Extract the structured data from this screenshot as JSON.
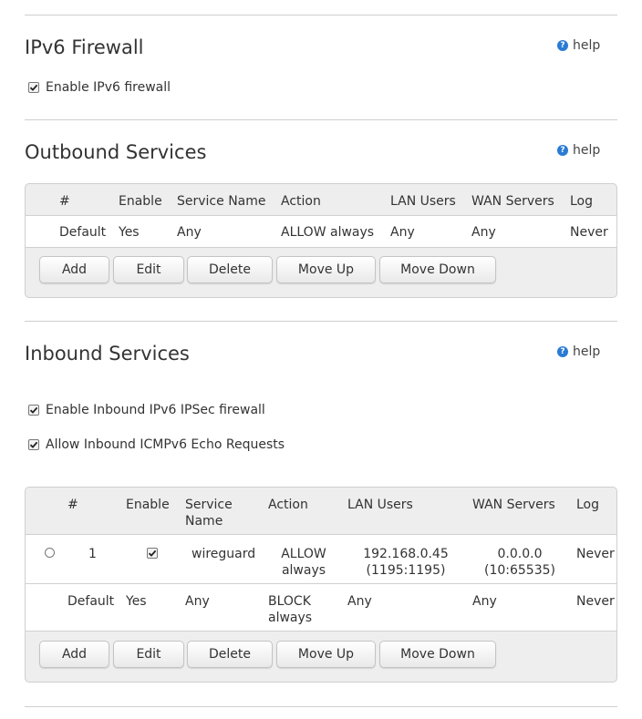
{
  "help_label": "help",
  "help_glyph": "?",
  "colors": {
    "accent": "#2a7bd4",
    "panel_bg": "#eeeeee",
    "border": "#cfcfcf",
    "text": "#333333"
  },
  "ipv6_firewall": {
    "title": "IPv6 Firewall",
    "enable_label": "Enable IPv6 firewall",
    "enable_checked": true
  },
  "outbound": {
    "title": "Outbound Services",
    "columns": [
      "#",
      "Enable",
      "Service Name",
      "Action",
      "LAN Users",
      "WAN Servers",
      "Log"
    ],
    "rows": [
      {
        "num": "Default",
        "enable": "Yes",
        "service": "Any",
        "action": "ALLOW always",
        "lan": "Any",
        "wan": "Any",
        "log": "Never"
      }
    ],
    "buttons": {
      "add": "Add",
      "edit": "Edit",
      "delete": "Delete",
      "move_up": "Move Up",
      "move_down": "Move Down"
    }
  },
  "inbound": {
    "title": "Inbound Services",
    "ipsec_label": "Enable Inbound IPv6 IPSec firewall",
    "ipsec_checked": true,
    "icmp_label": "Allow Inbound ICMPv6 Echo Requests",
    "icmp_checked": true,
    "columns": {
      "num": "#",
      "enable": "Enable",
      "service_l1": "Service",
      "service_l2": "Name",
      "action": "Action",
      "lan": "LAN Users",
      "wan": "WAN Servers",
      "log": "Log"
    },
    "rows": [
      {
        "selected": false,
        "num": "1",
        "enable_checked": true,
        "service": "wireguard",
        "action_l1": "ALLOW",
        "action_l2": "always",
        "lan_l1": "192.168.0.45",
        "lan_l2": "(1195:1195)",
        "wan_l1": "0.0.0.0",
        "wan_l2": "(10:65535)",
        "log": "Never"
      },
      {
        "num": "Default",
        "enable": "Yes",
        "service": "Any",
        "action_l1": "BLOCK",
        "action_l2": "always",
        "lan": "Any",
        "wan": "Any",
        "log": "Never"
      }
    ],
    "buttons": {
      "add": "Add",
      "edit": "Edit",
      "delete": "Delete",
      "move_up": "Move Up",
      "move_down": "Move Down"
    }
  }
}
